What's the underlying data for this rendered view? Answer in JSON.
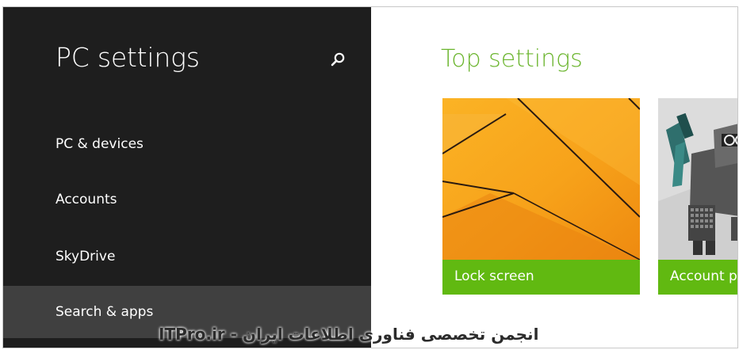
{
  "sidebar": {
    "title": "PC settings",
    "search_icon": "search-icon",
    "items": [
      {
        "label": "PC & devices"
      },
      {
        "label": "Accounts"
      },
      {
        "label": "SkyDrive"
      },
      {
        "label": "Search & apps",
        "selected": true
      }
    ]
  },
  "main": {
    "heading": "Top settings",
    "tiles": [
      {
        "label": "Lock screen"
      },
      {
        "label": "Account p"
      }
    ]
  },
  "colors": {
    "sidebar_bg": "#1e1e1e",
    "selected_item_bg": "#404040",
    "accent_green": "#61b911",
    "heading_green": "#6bb52e",
    "lock_art_orange": "#f7a21a"
  },
  "watermark": "ITPro.ir - انجمن تخصصی فناوری اطلاعات ایران"
}
